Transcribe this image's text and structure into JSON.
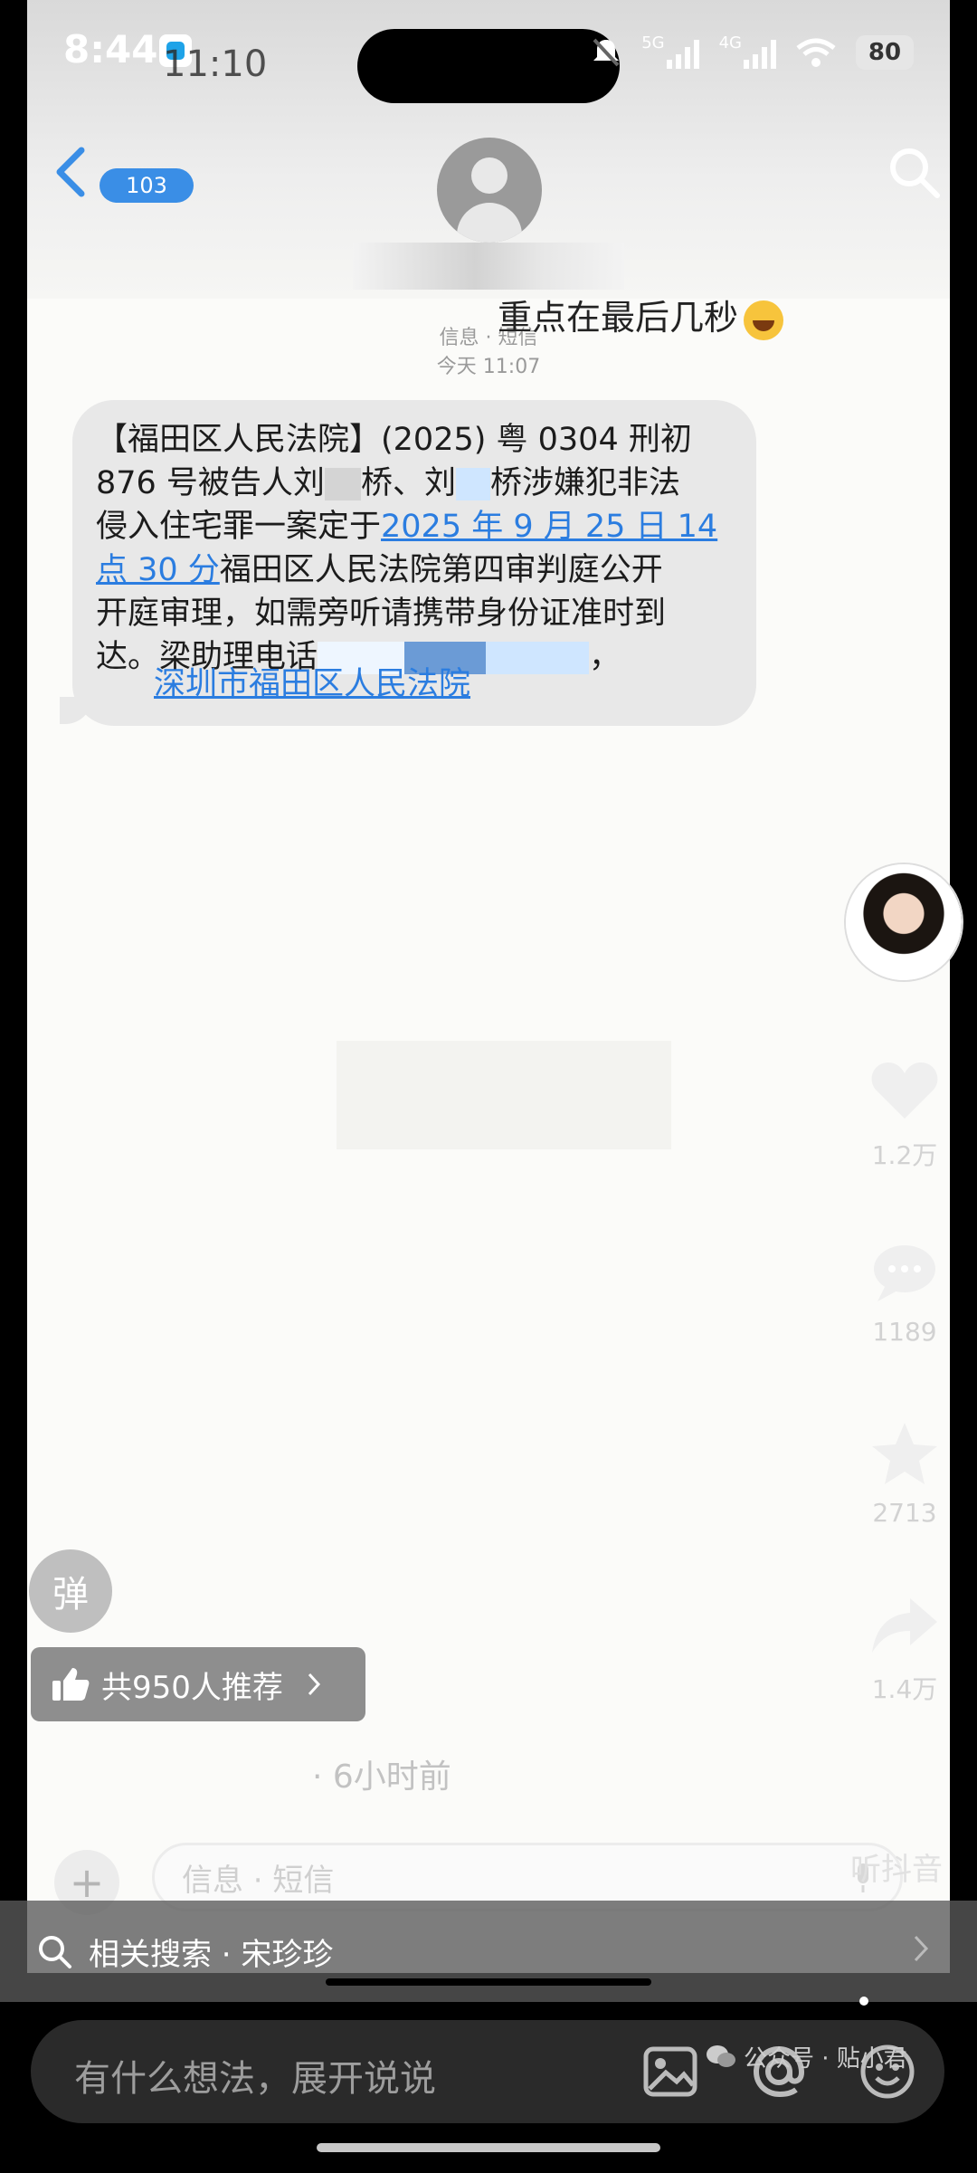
{
  "status_bar": {
    "time": "8:44",
    "time_ghost": "11:10",
    "network_labels": [
      "5G",
      "4G"
    ],
    "battery": "80"
  },
  "header": {
    "badge_count": "103"
  },
  "overlay_caption": "重点在最后几秒",
  "message": {
    "meta_channel": "信息 · 短信",
    "meta_time": "今天 11:07",
    "text_parts": {
      "p1": "【福田区人民法院】(2025) 粤 0304 刑初",
      "p2a": "876 号被告人刘",
      "p2b": "桥、刘",
      "p2c": "桥涉嫌犯非法",
      "p3a": "侵入住宅罪一案定于",
      "p3link": "2025 年 9 月 25 日 14",
      "p4link": "点 30 分",
      "p4b": "福田区人民法院第四审判庭公开",
      "p5": "开庭审理，如需旁听请携带身份证准时到",
      "p6a": "达。梁助理电话",
      "p6b": "，",
      "signature_link": "深圳市福田区人民法院"
    }
  },
  "side_actions": {
    "likes": "1.2万",
    "comments": "1189",
    "favorites": "2713",
    "shares": "1.4万"
  },
  "danmu_label": "弹",
  "recommend_label": "共950人推荐",
  "time_ago": "· 6小时前",
  "sms_input_placeholder": "信息 · 短信",
  "listen_watermark": "听抖音",
  "related_search": "相关搜索 · 宋珍珍",
  "comment_placeholder": "有什么想法，展开说说",
  "watermark": "公众号 · 贴小君",
  "colors": {
    "link_blue": "#2b7de0",
    "bubble_gray": "#e8e8e8",
    "badge_blue": "#3a8ee6"
  }
}
